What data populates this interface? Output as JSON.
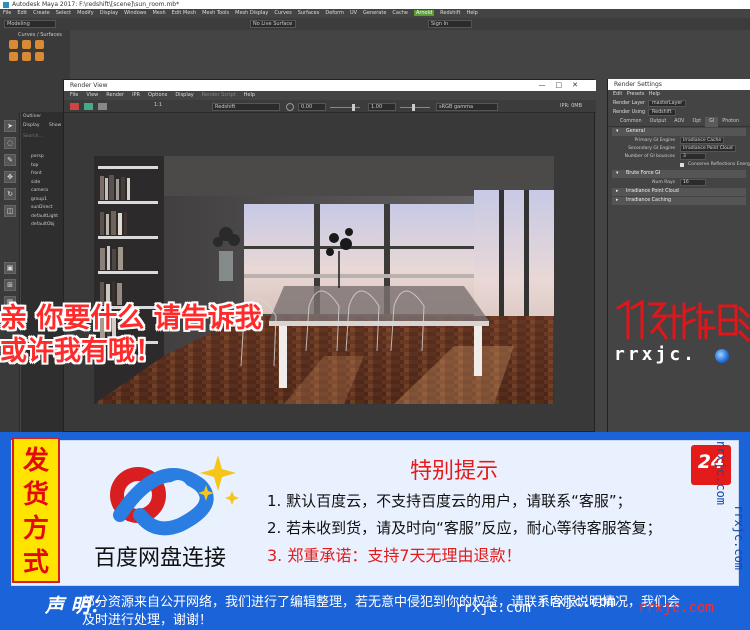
{
  "maya": {
    "title": "Autodesk Maya 2017: F:\\redshift\\[scene]\\sun_room.mb*",
    "menus": [
      "File",
      "Edit",
      "Create",
      "Select",
      "Modify",
      "Display",
      "Windows",
      "Mesh",
      "Edit Mesh",
      "Mesh Tools",
      "Mesh Display",
      "Curves",
      "Surfaces",
      "Deform",
      "UV",
      "Generate",
      "Cache",
      "Arnold",
      "Redshift",
      "Help"
    ],
    "mode_select": "Modeling",
    "live_surface": "No Live Surface",
    "sign_in": "Sign In",
    "shelf_tab": "Curves / Surfaces",
    "outliner_title": "Outliner",
    "outliner_menu": [
      "Display",
      "Show"
    ],
    "outliner_search": "Search...",
    "outliner_items": [
      "persp",
      "top",
      "front",
      "side",
      "camera",
      "group1",
      "sunDirect",
      "defaultLight",
      "defaultObj"
    ]
  },
  "render_view": {
    "title": "Render View",
    "menus": [
      "File",
      "View",
      "Render",
      "IPR",
      "Options",
      "Display",
      "Render Script",
      "Help"
    ],
    "ratio": "1:1",
    "renderer": "Redshift",
    "exposure": "0.00",
    "gamma": "1.00",
    "colorspace": "sRGB gamma",
    "ipr_status": "IPR: 0MB",
    "window_buttons": [
      "—",
      "□",
      "✕"
    ]
  },
  "render_settings": {
    "title": "Render Settings",
    "menus": [
      "Edit",
      "Presets",
      "Help"
    ],
    "render_layer_label": "Render Layer",
    "render_layer_value": "masterLayer",
    "render_using_label": "Render Using",
    "render_using_value": "Redshift",
    "tabs": [
      "Common",
      "Output",
      "AOV",
      "Opt",
      "GI",
      "Photon"
    ],
    "active_tab": "GI",
    "section_general": "General",
    "primary_label": "Primary GI Engine",
    "primary_value": "Irradiance Cache",
    "secondary_label": "Secondary GI Engine",
    "secondary_value": "Irradiance Point Cloud",
    "bounces_label": "Number of GI bounces",
    "bounces_value": "3",
    "conserve_label": "Conserve Reflections Energy",
    "section_brute": "Brute Force GI",
    "num_rays_label": "Num Rays",
    "num_rays_value": "16",
    "section_ipc": "Irradiance Point Cloud",
    "section_ic": "Irradiance Caching"
  },
  "overlay": {
    "promo_line1": "亲 你要什么 请告诉我",
    "promo_line2": "或许我有哦！",
    "stamp_url": "rrxjc.",
    "stamp_label": "竹子影视"
  },
  "banner": {
    "method_chars": [
      "发",
      "货",
      "方",
      "式"
    ],
    "baidu_title": "百度网盘连接",
    "tip_title": "特别提示",
    "tip1": "1. 默认百度云，不支持百度云的用户，请联系“客服”；",
    "tip2": "2. 若未收到货，请及时向“客服”反应，耐心等待客服答复；",
    "tip3": "3. 郑重承诺：支持7天无理由退款！",
    "logo24": "24",
    "vert_url_1": "rrxjc.com",
    "vert_url_2": "rrxjc.com",
    "notice_label": "声 明：",
    "notice_line1": "部分资源来自公开网络，我们进行了编辑整理，若无意中侵犯到你的权益，请联系客服说明情况，我们会",
    "notice_line2": "及时进行处理，谢谢！",
    "watermark_1": "rrxjc.com",
    "watermark_2": "rrxjc.com",
    "watermark_3": "rrxjc.com"
  },
  "colors": {
    "banner_blue": "#1b63d8",
    "accent_red": "#e21b1b",
    "method_yellow": "#ffe400"
  }
}
